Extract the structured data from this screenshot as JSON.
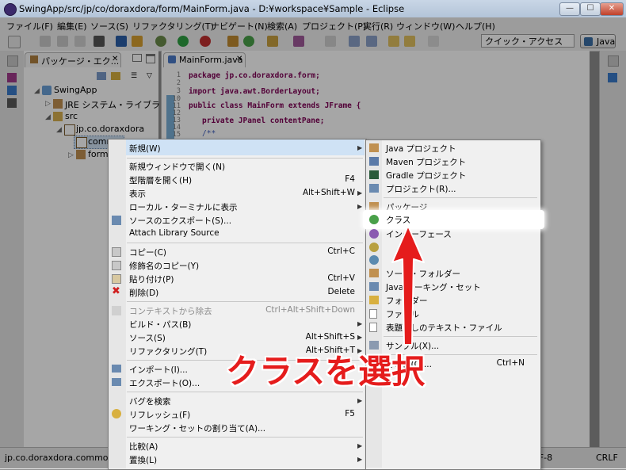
{
  "window": {
    "title": "SwingApp/src/jp/co/doraxdora/form/MainForm.java - D:¥workspace¥Sample - Eclipse"
  },
  "menubar": [
    "ファイル(F)",
    "編集(E)",
    "ソース(S)",
    "リファクタリング(T)",
    "ナビゲート(N)",
    "検索(A)",
    "プロジェクト(P)",
    "実行(R)",
    "ウィンドウ(W)",
    "ヘルプ(H)"
  ],
  "toolbar": {
    "quick_access_placeholder": "クイック・アクセス",
    "perspective": "Java"
  },
  "explorer": {
    "tab_label": "パッケージ・エク...",
    "items": [
      "SwingApp",
      "JRE システム・ライブラリー",
      "src",
      "jp.co.doraxdora",
      "common",
      "form"
    ]
  },
  "editor": {
    "tab_label": "MainForm.java",
    "line_numbers": [
      "1",
      "2",
      "3",
      "10",
      "11",
      "12",
      "13",
      "14",
      "15"
    ],
    "lines": [
      "package jp.co.doraxdora.form;",
      "import java.awt.BorderLayout;",
      "public class MainForm extends JFrame {",
      "private JPanel contentPane;",
      "/**"
    ]
  },
  "context_menu": {
    "items": [
      {
        "label": "新規(W)",
        "shortcut": ""
      },
      {
        "label": "新規ウィンドウで開く(N)",
        "shortcut": ""
      },
      {
        "label": "型階層を開く(H)",
        "shortcut": "F4"
      },
      {
        "label": "表示",
        "shortcut": "Alt+Shift+W"
      },
      {
        "label": "ローカル・ターミナルに表示",
        "shortcut": ""
      },
      {
        "label": "ソースのエクスポート(S)...",
        "shortcut": ""
      },
      {
        "label": "Attach Library Source",
        "shortcut": ""
      },
      {
        "label": "コピー(C)",
        "shortcut": "Ctrl+C"
      },
      {
        "label": "修飾名のコピー(Y)",
        "shortcut": ""
      },
      {
        "label": "貼り付け(P)",
        "shortcut": "Ctrl+V"
      },
      {
        "label": "削除(D)",
        "shortcut": "Delete"
      },
      {
        "label": "コンテキストから除去",
        "shortcut": "Ctrl+Alt+Shift+Down"
      },
      {
        "label": "ビルド・パス(B)",
        "shortcut": ""
      },
      {
        "label": "ソース(S)",
        "shortcut": "Alt+Shift+S"
      },
      {
        "label": "リファクタリング(T)",
        "shortcut": "Alt+Shift+T"
      },
      {
        "label": "インポート(I)...",
        "shortcut": ""
      },
      {
        "label": "エクスポート(O)...",
        "shortcut": ""
      },
      {
        "label": "バグを検索",
        "shortcut": ""
      },
      {
        "label": "リフレッシュ(F)",
        "shortcut": "F5"
      },
      {
        "label": "ワーキング・セットの割り当て(A)...",
        "shortcut": ""
      },
      {
        "label": "比較(A)",
        "shortcut": ""
      },
      {
        "label": "置換(L)",
        "shortcut": ""
      }
    ]
  },
  "submenu": {
    "items": [
      {
        "label": "Java プロジェクト",
        "shortcut": ""
      },
      {
        "label": "Maven プロジェクト",
        "shortcut": ""
      },
      {
        "label": "Gradle プロジェクト",
        "shortcut": ""
      },
      {
        "label": "プロジェクト(R)...",
        "shortcut": ""
      },
      {
        "label": "パッケージ",
        "shortcut": ""
      },
      {
        "label": "クラス",
        "shortcut": ""
      },
      {
        "label": "インターフェース",
        "shortcut": ""
      },
      {
        "label": "ソース・フォルダー",
        "shortcut": ""
      },
      {
        "label": "Java ワーキング・セット",
        "shortcut": ""
      },
      {
        "label": "フォルダー",
        "shortcut": ""
      },
      {
        "label": "ファイル",
        "shortcut": ""
      },
      {
        "label": "表題なしのテキスト・ファイル",
        "shortcut": ""
      },
      {
        "label": "サンプル(X)...",
        "shortcut": ""
      },
      {
        "label": "その他(O)...",
        "shortcut": "Ctrl+N"
      }
    ]
  },
  "statusbar": {
    "selection": "jp.co.doraxdora.common - S",
    "encoding": "UTF-8",
    "line_ending": "CRLF"
  },
  "annotation": "クラスを選択",
  "colors": {
    "annotation": "#e51c1c",
    "highlight": "#ffffff"
  }
}
